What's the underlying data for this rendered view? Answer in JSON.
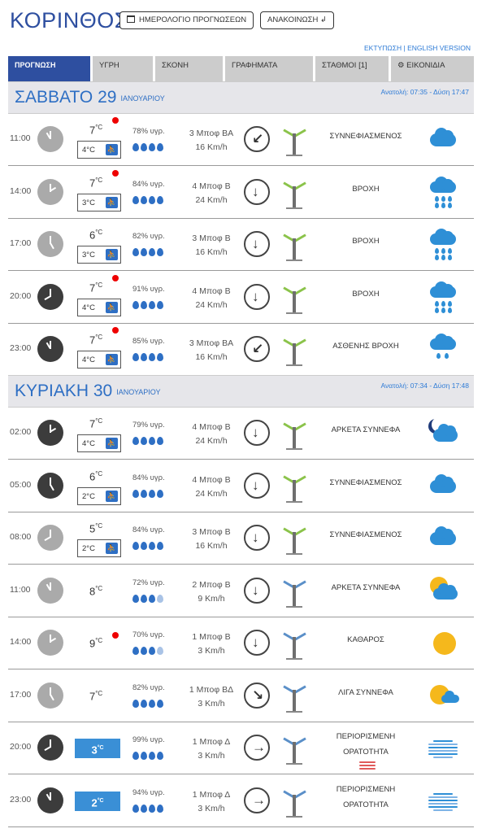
{
  "header": {
    "city": "ΚΟΡΙΝΘΟΣ",
    "calendar_button": "ΗΜΕΡΟΛΟΓΙΟ ΠΡΟΓΝΩΣΕΩΝ",
    "announcement_button": "ΑΝΑΚΟΙΝΩΣΗ",
    "print_link": "ΕΚΤΥΠΩΣΗ",
    "separator": "|",
    "english_link": "ENGLISH VERSION"
  },
  "tabs": [
    "ΠΡΟΓΝΩΣΗ",
    "ΥΓΡΗ",
    "ΣΚΟΝΗ",
    "ΓΡΑΦΗΜΑΤΑ",
    "ΣΤΑΘΜΟΙ  [1]",
    "ΕΙΚΟΝΙΔΙΑ"
  ],
  "days": [
    {
      "name": "ΣΑΒΒΑΤΟ 29",
      "month": "ΙΑΝΟΥΑΡΙΟΥ",
      "sun": "Ανατολή: 07:35  - Δύση 17:47",
      "rows": [
        {
          "time": "11:00",
          "night": false,
          "temp": "7",
          "unit": "°C",
          "hot": true,
          "feel": "4°C",
          "hum": "78% υγρ.",
          "drops": 4,
          "light_drops": 0,
          "wind_bf": "3 Μποφ ΒΑ",
          "wind_kmh": "16 Km/h",
          "arrow": "↙",
          "turbine": "green",
          "desc": "ΣΥΝΝΕΦΙΑΣΜΕΝΟΣ",
          "icon": "cloudy"
        },
        {
          "time": "14:00",
          "night": false,
          "temp": "7",
          "unit": "°C",
          "hot": true,
          "feel": "3°C",
          "hum": "84% υγρ.",
          "drops": 4,
          "light_drops": 0,
          "wind_bf": "4 Μποφ Β",
          "wind_kmh": "24 Km/h",
          "arrow": "↓",
          "turbine": "green",
          "desc": "ΒΡΟΧΗ",
          "icon": "rain"
        },
        {
          "time": "17:00",
          "night": false,
          "temp": "6",
          "unit": "°C",
          "hot": false,
          "feel": "3°C",
          "hum": "82% υγρ.",
          "drops": 4,
          "light_drops": 0,
          "wind_bf": "3 Μποφ Β",
          "wind_kmh": "16 Km/h",
          "arrow": "↓",
          "turbine": "green",
          "desc": "ΒΡΟΧΗ",
          "icon": "rain"
        },
        {
          "time": "20:00",
          "night": true,
          "temp": "7",
          "unit": "°C",
          "hot": true,
          "feel": "4°C",
          "hum": "91% υγρ.",
          "drops": 4,
          "light_drops": 0,
          "wind_bf": "4 Μποφ Β",
          "wind_kmh": "24 Km/h",
          "arrow": "↓",
          "turbine": "green",
          "desc": "ΒΡΟΧΗ",
          "icon": "rain"
        },
        {
          "time": "23:00",
          "night": true,
          "temp": "7",
          "unit": "°C",
          "hot": true,
          "feel": "4°C",
          "hum": "85% υγρ.",
          "drops": 4,
          "light_drops": 0,
          "wind_bf": "3 Μποφ ΒΑ",
          "wind_kmh": "16 Km/h",
          "arrow": "↙",
          "turbine": "green",
          "desc": "ΑΣΘΕΝΗΣ ΒΡΟΧΗ",
          "icon": "lightrain"
        }
      ]
    },
    {
      "name": "ΚΥΡΙΑΚΗ 30",
      "month": "ΙΑΝΟΥΑΡΙΟΥ",
      "sun": "Ανατολή: 07:34  - Δύση 17:48",
      "rows": [
        {
          "time": "02:00",
          "night": true,
          "temp": "7",
          "unit": "°C",
          "hot": false,
          "feel": "4°C",
          "hum": "79% υγρ.",
          "drops": 4,
          "light_drops": 0,
          "wind_bf": "4 Μποφ Β",
          "wind_kmh": "24 Km/h",
          "arrow": "↓",
          "turbine": "green",
          "desc": "ΑΡΚΕΤΑ ΣΥΝΝΕΦΑ",
          "icon": "moonclouds"
        },
        {
          "time": "05:00",
          "night": true,
          "temp": "6",
          "unit": "°C",
          "hot": false,
          "feel": "2°C",
          "hum": "84% υγρ.",
          "drops": 4,
          "light_drops": 0,
          "wind_bf": "4 Μποφ Β",
          "wind_kmh": "24 Km/h",
          "arrow": "↓",
          "turbine": "green",
          "desc": "ΣΥΝΝΕΦΙΑΣΜΕΝΟΣ",
          "icon": "cloudy"
        },
        {
          "time": "08:00",
          "night": false,
          "temp": "5",
          "unit": "°C",
          "hot": false,
          "feel": "2°C",
          "hum": "84% υγρ.",
          "drops": 4,
          "light_drops": 0,
          "wind_bf": "3 Μποφ Β",
          "wind_kmh": "16 Km/h",
          "arrow": "↓",
          "turbine": "green",
          "desc": "ΣΥΝΝΕΦΙΑΣΜΕΝΟΣ",
          "icon": "cloudy"
        },
        {
          "time": "11:00",
          "night": false,
          "temp": "8",
          "unit": "°C",
          "hot": false,
          "feel": "",
          "hum": "72% υγρ.",
          "drops": 3,
          "light_drops": 1,
          "wind_bf": "2 Μποφ Β",
          "wind_kmh": "9 Km/h",
          "arrow": "↓",
          "turbine": "blue",
          "desc": "ΑΡΚΕΤΑ ΣΥΝΝΕΦΑ",
          "icon": "sunclouds"
        },
        {
          "time": "14:00",
          "night": false,
          "temp": "9",
          "unit": "°C",
          "hot": true,
          "feel": "",
          "hum": "70% υγρ.",
          "drops": 3,
          "light_drops": 1,
          "wind_bf": "1 Μποφ Β",
          "wind_kmh": "3 Km/h",
          "arrow": "↓",
          "turbine": "blue",
          "desc": "ΚΑΘΑΡΟΣ",
          "icon": "sun"
        },
        {
          "time": "17:00",
          "night": false,
          "temp": "7",
          "unit": "°C",
          "hot": false,
          "feel": "",
          "hum": "82% υγρ.",
          "drops": 4,
          "light_drops": 0,
          "wind_bf": "1 Μποφ ΒΔ",
          "wind_kmh": "3 Km/h",
          "arrow": "↘",
          "turbine": "blue",
          "desc": "ΛΙΓΑ ΣΥΝΝΕΦΑ",
          "icon": "suncloud"
        },
        {
          "time": "20:00",
          "night": true,
          "temp": "3",
          "unit": "°C",
          "hot": false,
          "cold": true,
          "feel": "",
          "hum": "99% υγρ.",
          "drops": 4,
          "light_drops": 0,
          "wind_bf": "1 Μποφ Δ",
          "wind_kmh": "3 Km/h",
          "arrow": "→",
          "turbine": "blue",
          "desc": "ΠΕΡΙΟΡΙΣΜΕΝΗ ΟΡΑΤΟΤΗΤΑ",
          "icon": "fog",
          "red_fog": true
        },
        {
          "time": "23:00",
          "night": true,
          "temp": "2",
          "unit": "°C",
          "hot": false,
          "cold": true,
          "feel": "",
          "hum": "94% υγρ.",
          "drops": 4,
          "light_drops": 0,
          "wind_bf": "1 Μποφ Δ",
          "wind_kmh": "3 Km/h",
          "arrow": "→",
          "turbine": "blue",
          "desc": "ΠΕΡΙΟΡΙΣΜΕΝΗ ΟΡΑΤΟΤΗΤΑ",
          "icon": "fog2"
        }
      ]
    }
  ],
  "colors": {
    "brand": "#2e4fa0",
    "accent": "#2e8fd6",
    "hot": "#e00000",
    "cold": "#3a8fd6"
  }
}
